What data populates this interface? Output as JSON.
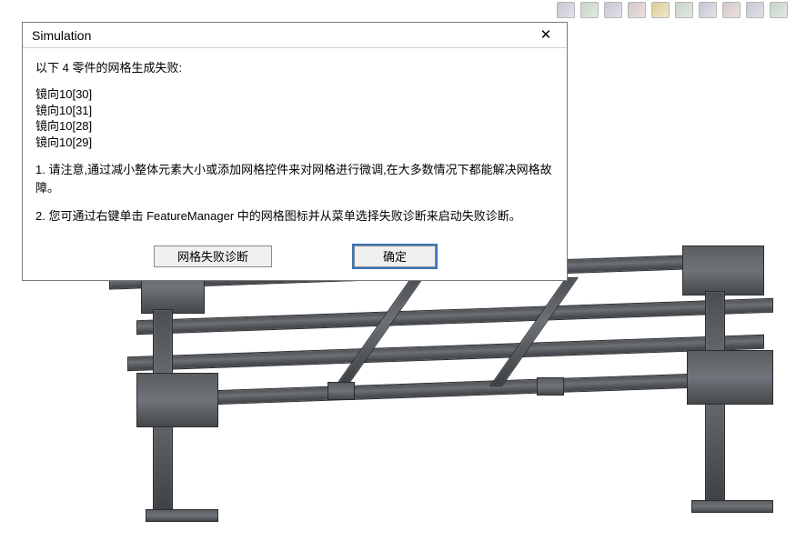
{
  "toolbar": {
    "icons": [
      "cube-icon",
      "section-icon",
      "spanner-icon",
      "cube2-icon",
      "globe-icon",
      "sphere-icon",
      "layers-icon",
      "doc-icon",
      "grid-icon",
      "chart-icon"
    ]
  },
  "dialog": {
    "title": "Simulation",
    "close_label": "✕",
    "message_heading": "以下 4 零件的网格生成失败:",
    "failed_parts": [
      "镜向10[30]",
      "镜向10[31]",
      "镜向10[28]",
      "镜向10[29]"
    ],
    "note1": "1. 请注意,通过减小整体元素大小或添加网格控件来对网格进行微调,在大多数情况下都能解决网格故障。",
    "note2": "2. 您可通过右键单击 FeatureManager 中的网格图标并从菜单选择失败诊断来启动失败诊断。",
    "btn_diagnose": "网格失败诊断",
    "btn_ok": "确定"
  }
}
